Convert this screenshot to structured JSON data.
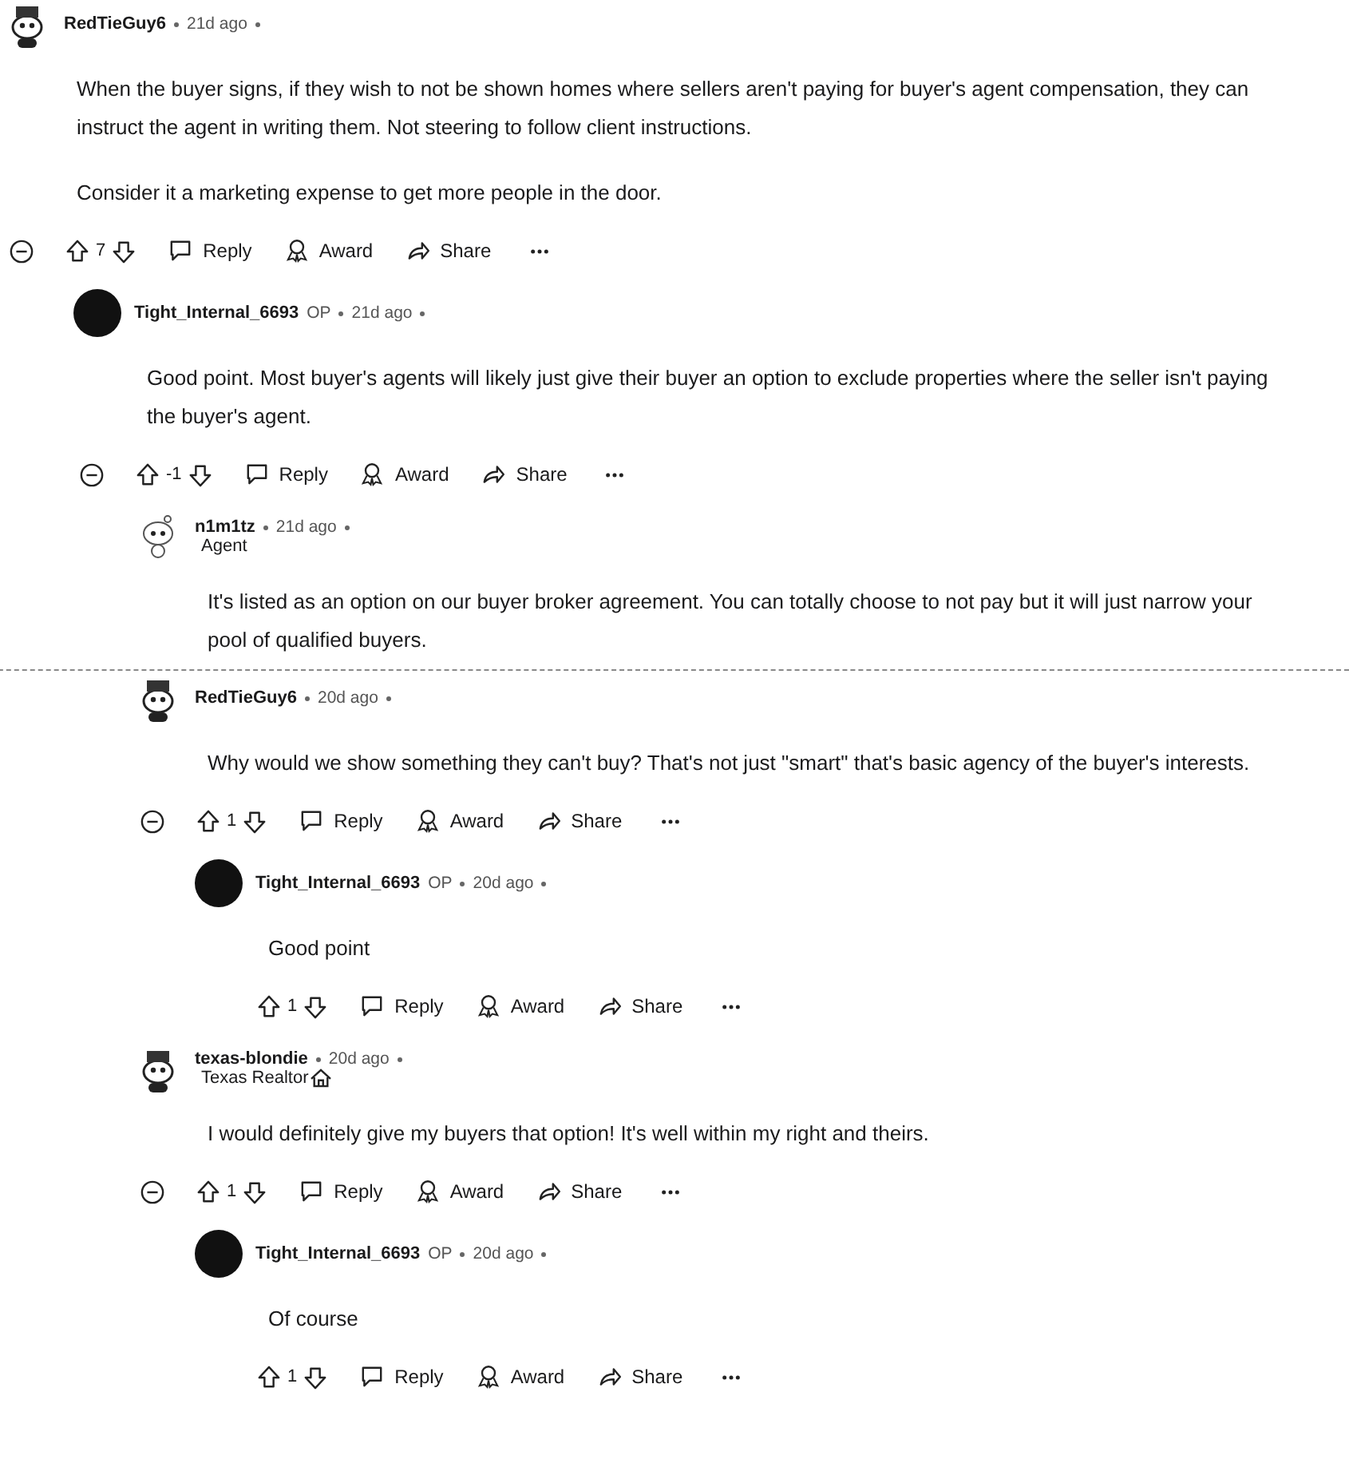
{
  "comments": [
    {
      "author": "RedTieGuy6",
      "avatar": {
        "kind": "snoo"
      },
      "time": "21d ago",
      "collapsible": true,
      "body": [
        "When the buyer signs, if they wish to not be shown homes where sellers aren't paying for buyer's agent compensation, they can instruct the agent in writing them. Not steering to follow client instructions.",
        "Consider it a marketing expense to get more people in the door."
      ],
      "score": "7",
      "actions": [
        {
          "kind": "reply",
          "label": "Reply"
        },
        {
          "kind": "award",
          "label": "Award"
        },
        {
          "kind": "share",
          "label": "Share"
        }
      ],
      "children": [
        {
          "author": "Tight_Internal_6693",
          "badge": "OP",
          "avatar": {
            "kind": "dark"
          },
          "time": "21d ago",
          "collapsible": true,
          "body": [
            "Good point. Most buyer's agents will likely just give their buyer an option to exclude properties where the seller isn't paying the buyer's agent."
          ],
          "score": "-1",
          "actions": [
            {
              "kind": "reply",
              "label": "Reply"
            },
            {
              "kind": "award",
              "label": "Award"
            },
            {
              "kind": "share",
              "label": "Share"
            }
          ],
          "children": [
            {
              "author": "n1m1tz",
              "avatar": {
                "kind": "outline"
              },
              "time": "21d ago",
              "flair": "Agent",
              "body": [
                "It's listed as an option on our buyer broker agreement. You can totally choose to not pay but it will just narrow your pool of qualified buyers."
              ]
            },
            {
              "author": "RedTieGuy6",
              "avatar": {
                "kind": "snoo"
              },
              "time": "20d ago",
              "cut_above": true,
              "collapsible": true,
              "body": [
                "Why would we show something they can't buy? That's not just \"smart\" that's basic agency of the buyer's interests."
              ],
              "score": "1",
              "actions": [
                {
                  "kind": "reply",
                  "label": "Reply"
                },
                {
                  "kind": "award",
                  "label": "Award"
                },
                {
                  "kind": "share",
                  "label": "Share"
                }
              ],
              "children": [
                {
                  "author": "Tight_Internal_6693",
                  "badge": "OP",
                  "avatar": {
                    "kind": "dark"
                  },
                  "time": "20d ago",
                  "collapsible": false,
                  "body": [
                    "Good point"
                  ],
                  "score": "1",
                  "actions": [
                    {
                      "kind": "reply",
                      "label": "Reply"
                    },
                    {
                      "kind": "award",
                      "label": "Award"
                    },
                    {
                      "kind": "share",
                      "label": "Share"
                    }
                  ]
                }
              ]
            },
            {
              "author": "texas-blondie",
              "avatar": {
                "kind": "snoo"
              },
              "time": "20d ago",
              "flair": "Texas Realtor",
              "flair_icon": {
                "kind": "house"
              },
              "collapsible": true,
              "body": [
                "I would definitely give my buyers that option! It's well within my right and theirs."
              ],
              "score": "1",
              "actions": [
                {
                  "kind": "reply",
                  "label": "Reply"
                },
                {
                  "kind": "award",
                  "label": "Award"
                },
                {
                  "kind": "share",
                  "label": "Share"
                }
              ],
              "children": [
                {
                  "author": "Tight_Internal_6693",
                  "badge": "OP",
                  "avatar": {
                    "kind": "dark"
                  },
                  "time": "20d ago",
                  "collapsible": false,
                  "body": [
                    "Of course"
                  ],
                  "score": "1",
                  "actions": [
                    {
                      "kind": "reply",
                      "label": "Reply"
                    },
                    {
                      "kind": "award",
                      "label": "Award"
                    },
                    {
                      "kind": "share",
                      "label": "Share"
                    }
                  ]
                }
              ]
            }
          ]
        }
      ]
    }
  ]
}
